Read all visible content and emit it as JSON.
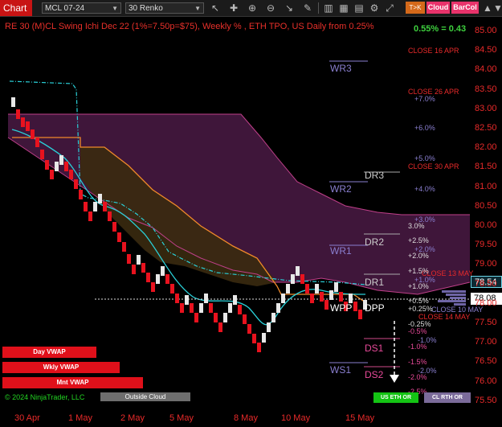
{
  "toolbar": {
    "chart_tab": "Chart",
    "instrument": "MCL 07-24",
    "period": "30 Renko",
    "icons": [
      "pointer-icon",
      "crosshair-icon",
      "zoom-in-icon",
      "zoom-out-icon",
      "arrow-icon",
      "pencil-icon",
      "chart-type-icon",
      "grid-icon",
      "bar-chart-icon",
      "settings-icon",
      "expand-icon"
    ],
    "btn_tok": "T>K",
    "btn_cloud": "Cloud",
    "btn_barcol": "BarCol"
  },
  "chart": {
    "title": "RE 30 (M)CL Swing Ichi Dec 22  (1%=7.50p=$75), Weekly % , ETH TPO, US Daily from 0.25%",
    "percent_readout": "0.55% = 0.43",
    "copyright": "© 2024 NinjaTrader, LLC",
    "price_tag_cyan": "78.54",
    "price_tag_white": "78.08",
    "colors": {
      "up": "#e8e8e8",
      "down": "#e8121e",
      "tenkan": "#2ad0d8",
      "kijun": "#f08a2a",
      "cloud_bear": "#4a1a44",
      "cloud_bull": "#3a2a10",
      "accent": "#e8302a"
    }
  },
  "levels": {
    "wr3": "WR3",
    "wr2": "WR2",
    "wr1": "WR1",
    "wpp": "WPP",
    "ws1": "WS1",
    "dr3": "DR3",
    "dr2": "DR2",
    "dr1": "DR1",
    "dpp": "DPP",
    "ds1": "DS1",
    "ds2": "DS2",
    "close_16apr": "CLOSE 16 APR",
    "close_26apr": "CLOSE 26 APR",
    "close_30apr": "CLOSE 30 APR",
    "close_13may": "CLOSE 13 MAY",
    "close_10may": "CLOSE 10 MAY",
    "close_14may": "CLOSE 14 MAY",
    "w_p7": "+7.0%",
    "w_p6": "+6.0%",
    "w_p5": "+5.0%",
    "w_p4": "+4.0%",
    "w_p3": "+3.0%",
    "w_p2": "+2.0%",
    "w_p1": "+1.0%",
    "w_m1": "-1.0%",
    "w_m2": "-2.0%",
    "d_p3": "3.0%",
    "d_p25": "+2.5%",
    "d_p2": "+2.0%",
    "d_p15": "+1.5%",
    "d_p1": "+1.0%",
    "d_p05": "+0.5%",
    "d_p025": "+0.25%",
    "d_m025": "-0.25%",
    "d_m05": "-0.5%",
    "d_m1": "-1.0%",
    "d_m15": "-1.5%",
    "d_m2": "-2.0%",
    "d_m25": "-2.5%"
  },
  "buttons": {
    "day_vwap": "Day VWAP",
    "wkly_vwap": "Wkly VWAP",
    "mnt_vwap": "Mnt VWAP",
    "outside_cloud": "Outside Cloud",
    "us_eth_or": "US ETH OR",
    "cl_rth_or": "CL RTH OR"
  },
  "y_axis": [
    "85.00",
    "84.50",
    "84.00",
    "83.50",
    "83.00",
    "82.50",
    "82.00",
    "81.50",
    "81.00",
    "80.50",
    "80.00",
    "79.50",
    "79.00",
    "78.50",
    "78.00",
    "77.50",
    "77.00",
    "76.50",
    "76.00",
    "75.50"
  ],
  "x_axis": [
    "30 Apr",
    "1 May",
    "2 May",
    "5 May",
    "8 May",
    "10 May",
    "15 May"
  ]
}
